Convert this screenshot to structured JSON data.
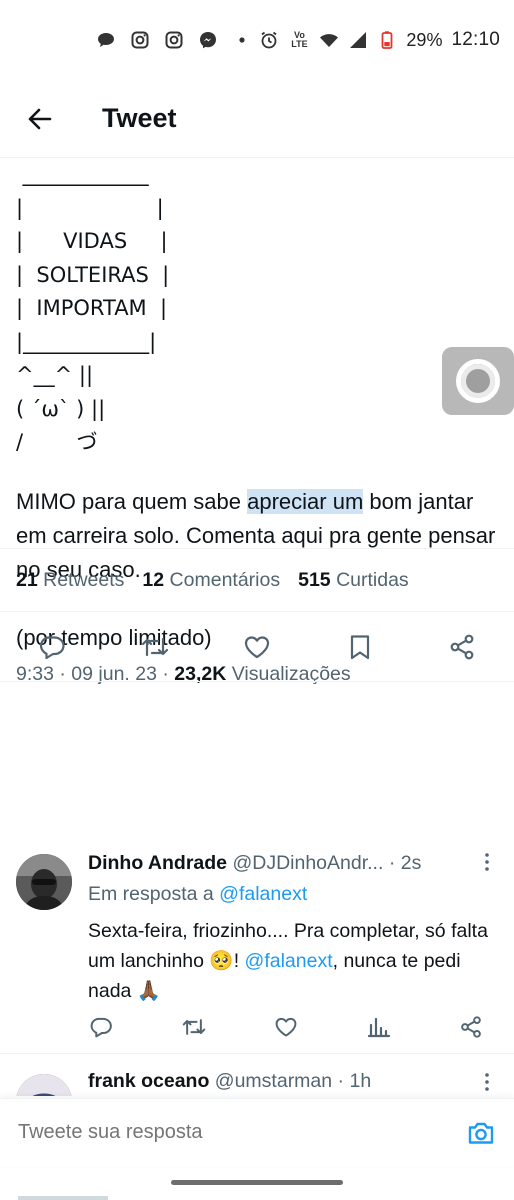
{
  "status_bar": {
    "battery": "29%",
    "time": "12:10",
    "icons": [
      "chat-bubble-icon",
      "instagram-icon",
      "instagram-icon",
      "messenger-icon",
      "dot-icon",
      "alarm-icon",
      "volte-icon",
      "wifi-icon",
      "signal-icon",
      "battery-icon"
    ],
    "volte_label": "Vo LTE"
  },
  "header": {
    "title": "Tweet"
  },
  "tweet": {
    "ascii_art": " ____________\n|                    |\n|      VIDAS     |\n|  SOLTEIRAS  |\n|  IMPORTAM  |\n|____________|\n^__^ ||\n( ´ω` ) ||\n/        づ",
    "text_before_highlight": "MIMO para quem sabe ",
    "text_highlight": "apreciar um",
    "text_after_highlight": " bom jantar em carreira solo. Comenta aqui pra gente pensar no seu caso.",
    "text_second": "(por tempo limitado)",
    "time": "9:33",
    "date": "09 jun. 23",
    "views_count": "23,2K",
    "views_label": "Visualizações",
    "retweets_count": "21",
    "retweets_label": "Retweets",
    "comments_count": "12",
    "comments_label": "Comentários",
    "likes_count": "515",
    "likes_label": "Curtidas"
  },
  "replies": [
    {
      "name": "Dinho Andrade",
      "handle": "@DJDinhoAndr...",
      "age": "2s",
      "reply_to_label": "Em resposta a",
      "reply_to_handle": "@falanext",
      "text_part1": "Sexta-feira, friozinho.... Pra completar, só falta um lanchinho 🥺! ",
      "mention": "@falanext",
      "text_part2": ", nunca te pedi nada 🙏🏾"
    },
    {
      "name": "frank oceano",
      "handle": "@umstarman",
      "age": "1h"
    }
  ],
  "compose": {
    "placeholder": "Tweete sua resposta"
  },
  "colors": {
    "accent": "#1d9bf0",
    "highlight": "#cfe3f5",
    "secondary_text": "#536471",
    "primary_text": "#0f1419"
  }
}
